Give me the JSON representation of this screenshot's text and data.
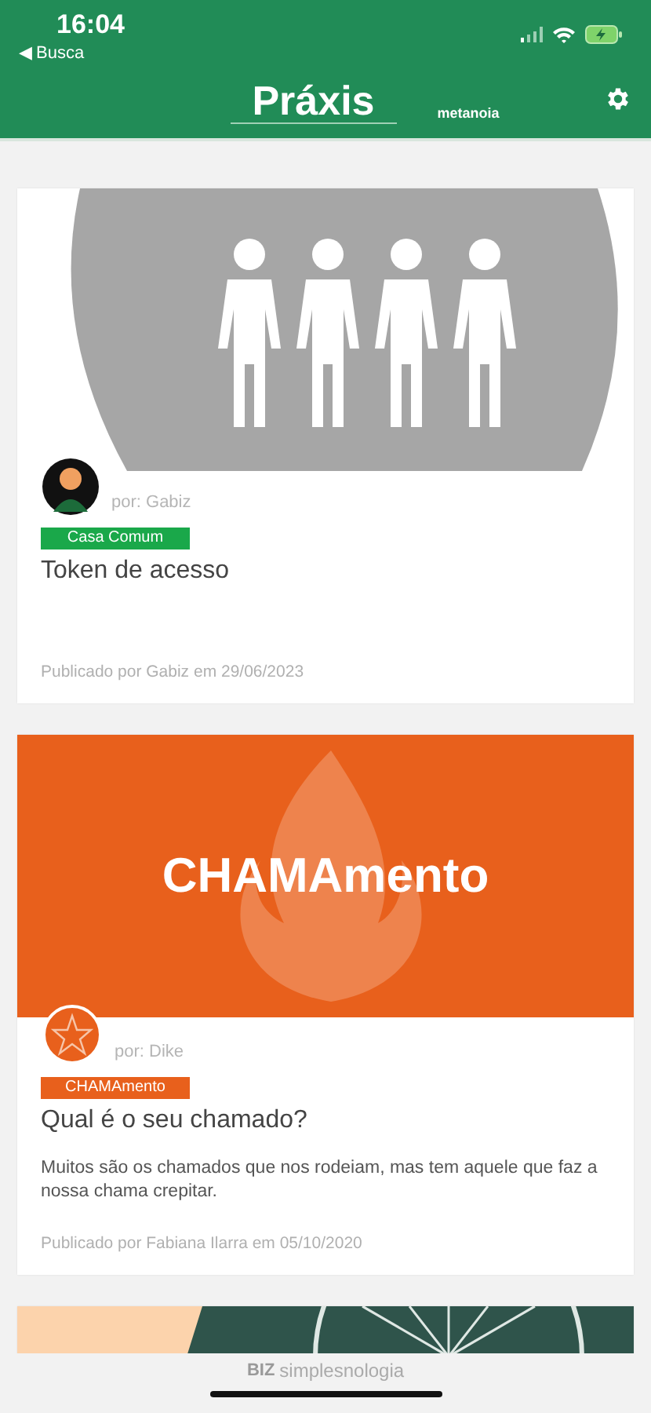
{
  "status_bar": {
    "time": "16:04",
    "back": "◀ Busca"
  },
  "header": {
    "title": "Práxis",
    "subtitle": "metanoia"
  },
  "posts": [
    {
      "image": {
        "kind": "people"
      },
      "avatar": {
        "kind": "figure"
      },
      "author": "por: Gabiz",
      "tag": "Casa Comum",
      "color": "#1aa84a",
      "title": "Token de acesso",
      "published": "Publicado por Gabiz em 29/06/2023"
    },
    {
      "image": {
        "kind": "flame",
        "text": "CHAMAmento"
      },
      "avatar": {
        "kind": "star"
      },
      "author": "por: Dike",
      "tag": "CHAMAmento",
      "color": "#e8601c",
      "title": "Qual é o seu chamado?",
      "excerpt": "Muitos são os chamados que nos rodeiam, mas tem aquele que faz a nossa chama crepitar.",
      "published": "Publicado por Fabiana Ilarra em 05/10/2020"
    },
    {
      "image": {
        "kind": "wheel"
      }
    }
  ],
  "footer": {
    "brand": "BIZ",
    "text": "simplesnologia"
  }
}
